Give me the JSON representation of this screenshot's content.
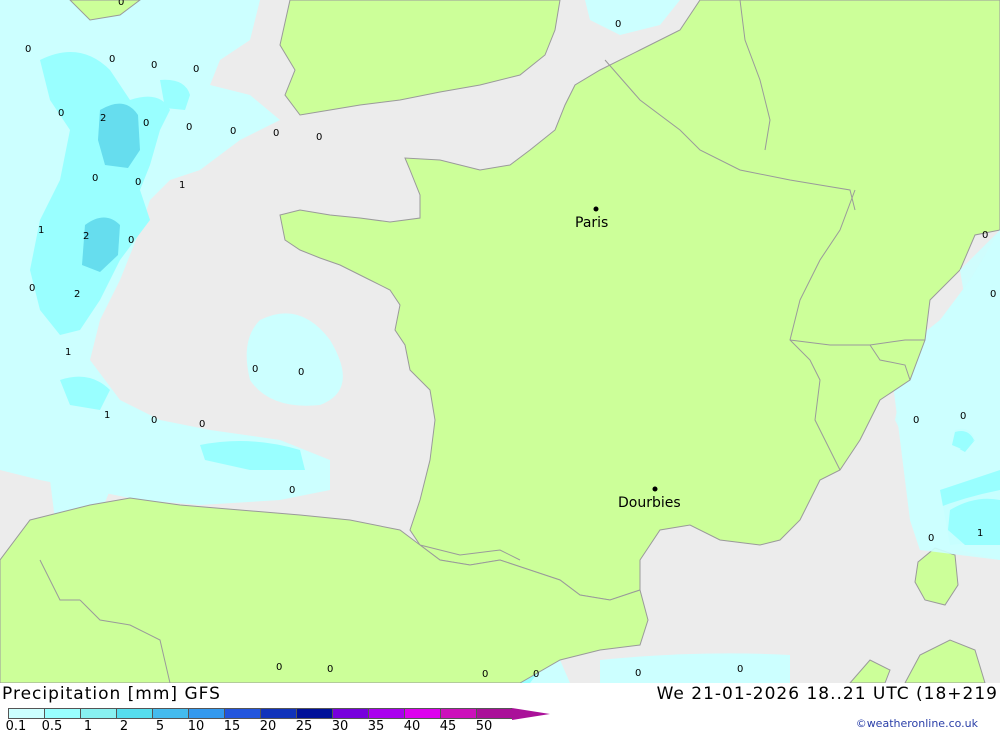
{
  "map": {
    "colors": {
      "sea": "#ececec",
      "land": "#ccff99",
      "border": "#9a9a9a",
      "precip_light": "#ccffff",
      "precip_mid": "#99ffff",
      "precip_heavy": "#66ddee"
    },
    "cities": [
      "Paris",
      "Dourbies"
    ],
    "contour_labels": [
      "0",
      "0",
      "0",
      "0",
      "0",
      "0",
      "0",
      "0",
      "2",
      "0",
      "0",
      "0",
      "0",
      "0",
      "1",
      "0",
      "0",
      "1",
      "2",
      "0",
      "0",
      "2",
      "1",
      "0",
      "0",
      "1",
      "0",
      "0",
      "0",
      "0",
      "0",
      "0",
      "0",
      "0",
      "0",
      "0",
      "1",
      "0",
      "0",
      "0"
    ]
  },
  "footer": {
    "title": "Precipitation [mm] GFS",
    "datetime": "We 21-01-2026 18..21 UTC (18+219",
    "credit": "©weatheronline.co.uk",
    "scale": [
      {
        "label": "0.1",
        "color": "#ccffff"
      },
      {
        "label": "0.5",
        "color": "#99ffff"
      },
      {
        "label": "1",
        "color": "#88f0f0"
      },
      {
        "label": "2",
        "color": "#55ddee"
      },
      {
        "label": "5",
        "color": "#44bbee"
      },
      {
        "label": "10",
        "color": "#3399ee"
      },
      {
        "label": "15",
        "color": "#2255dd"
      },
      {
        "label": "20",
        "color": "#1133bb"
      },
      {
        "label": "25",
        "color": "#001199"
      },
      {
        "label": "30",
        "color": "#7700dd"
      },
      {
        "label": "35",
        "color": "#aa00ee"
      },
      {
        "label": "40",
        "color": "#dd00ee"
      },
      {
        "label": "45",
        "color": "#cc11bb"
      },
      {
        "label": "50",
        "color": "#aa1199"
      }
    ]
  }
}
